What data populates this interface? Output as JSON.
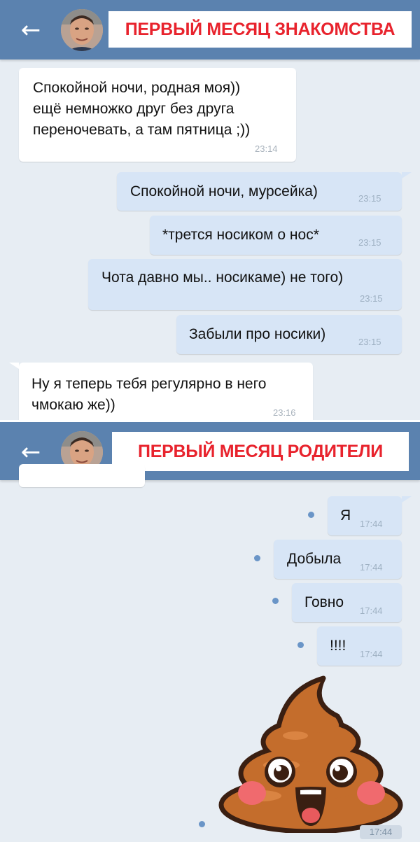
{
  "panel1": {
    "header": {
      "back_icon": "←",
      "avatar": "avatar",
      "title": "ПЕРВЫЙ МЕСЯЦ ЗНАКОМСТВА"
    },
    "messages": [
      {
        "dir": "in",
        "text": "Спокойной ночи, родная моя))\nещё немножко друг без друга\nпереночевать, а там пятница ;))",
        "time": "23:14"
      },
      {
        "dir": "out",
        "text": "Спокойной ночи, мурсейка)",
        "time": "23:15"
      },
      {
        "dir": "out",
        "text": "*трется носиком о нос*",
        "time": "23:15"
      },
      {
        "dir": "out",
        "text": "Чота давно мы.. носикаме) не того)",
        "time": "23:15"
      },
      {
        "dir": "out",
        "text": "Забыли про носики)",
        "time": "23:15"
      },
      {
        "dir": "in",
        "text": "Ну я теперь тебя регулярно в него\nчмокаю же))",
        "time": "23:16"
      }
    ]
  },
  "panel2": {
    "header": {
      "back_icon": "←",
      "avatar": "avatar",
      "title": "ПЕРВЫЙ МЕСЯЦ РОДИТЕЛИ"
    },
    "messages": [
      {
        "dir": "out",
        "text": "Я",
        "time": "17:44",
        "unread": true
      },
      {
        "dir": "out",
        "text": "Добыла",
        "time": "17:44",
        "unread": true
      },
      {
        "dir": "out",
        "text": "Говно",
        "time": "17:44",
        "unread": true
      },
      {
        "dir": "out",
        "text": "!!!!",
        "time": "17:44",
        "unread": true
      }
    ],
    "sticker": {
      "name": "poop-emoji-sticker",
      "time": "17:44",
      "unread": true
    }
  },
  "colors": {
    "header": "#5b82af",
    "title": "#e8232d",
    "bubble_out": "#d7e5f6",
    "bubble_in": "#ffffff",
    "chat_bg": "#e7edf3",
    "unread_dot": "#6a95c7"
  }
}
